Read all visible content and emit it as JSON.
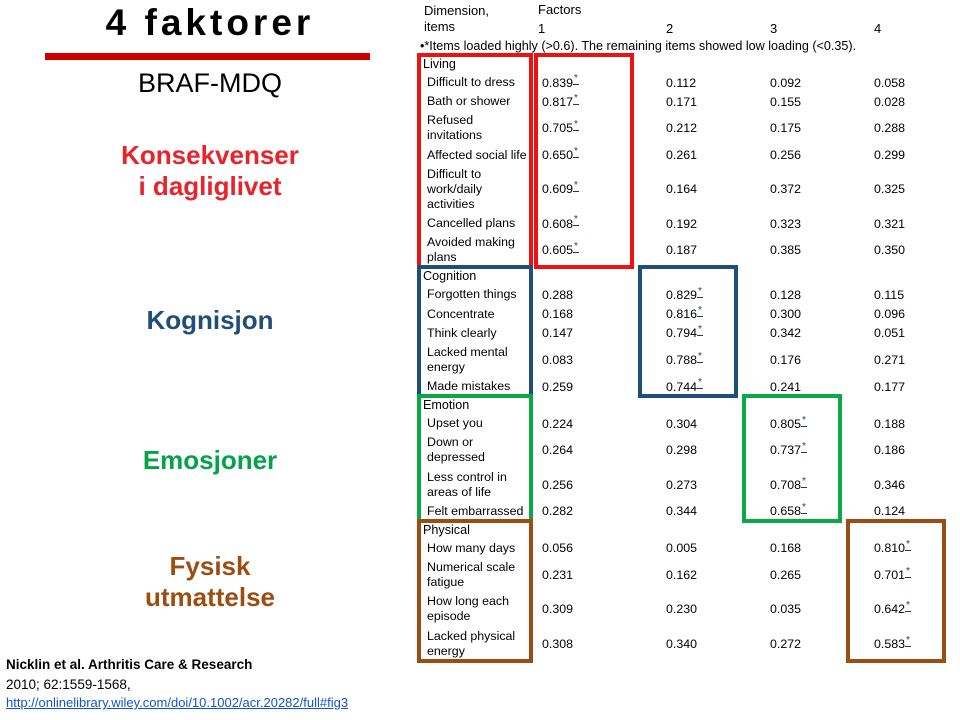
{
  "left": {
    "title": "4 faktorer",
    "subtitle": "BRAF-MDQ",
    "factor_labels": [
      {
        "text": "Konsekvenser\ni dagliglivet",
        "color": "#E8232A"
      },
      {
        "text": "Kognisjon",
        "color": "#1F4E79"
      },
      {
        "text": "Emosjoner",
        "color": "#06A24B"
      },
      {
        "text": "Fysisk\nutmattelse",
        "color": "#9C4D12"
      }
    ],
    "citation": {
      "line1": "Nicklin et al. Arthritis Care & Research",
      "line2": "2010; 62:1559-1568,",
      "link": "http://onlinelibrary.wiley.com/doi/10.1002/acr.20282/full#fig3"
    },
    "rule_color": "#CC0000"
  },
  "table": {
    "header": {
      "dimension_label": "Dimension,\nitems",
      "dimension_line1": "Dimension,",
      "dimension_line2": "items",
      "factors_label": "Factors",
      "factor_numbers": [
        "1",
        "2",
        "3",
        "4"
      ]
    },
    "note": "•*Items loaded highly (>0.6). The remaining items showed low loading (<0.35).",
    "sections": [
      {
        "name": "Living",
        "highlight_color": "#EE1111",
        "highlight_factor": 1,
        "rows": [
          {
            "item": "Difficult to dress",
            "values": [
              "0.839",
              "0.112",
              "0.092",
              "0.058"
            ],
            "starred": 1
          },
          {
            "item": "Bath or shower",
            "values": [
              "0.817",
              "0.171",
              "0.155",
              "0.028"
            ],
            "starred": 1
          },
          {
            "item": "Refused invitations",
            "values": [
              "0.705",
              "0.212",
              "0.175",
              "0.288"
            ],
            "starred": 1
          },
          {
            "item": "Affected social life",
            "values": [
              "0.650",
              "0.261",
              "0.256",
              "0.299"
            ],
            "starred": 1
          },
          {
            "item": "Difficult to work/daily activities",
            "values": [
              "0.609",
              "0.164",
              "0.372",
              "0.325"
            ],
            "starred": 1
          },
          {
            "item": "Cancelled plans",
            "values": [
              "0.608",
              "0.192",
              "0.323",
              "0.321"
            ],
            "starred": 1
          },
          {
            "item": "Avoided making plans",
            "values": [
              "0.605",
              "0.187",
              "0.385",
              "0.350"
            ],
            "starred": 1
          }
        ]
      },
      {
        "name": "Cognition",
        "highlight_color": "#1F4E79",
        "highlight_factor": 2,
        "rows": [
          {
            "item": "Forgotten things",
            "values": [
              "0.288",
              "0.829",
              "0.128",
              "0.115"
            ],
            "starred": 2
          },
          {
            "item": "Concentrate",
            "values": [
              "0.168",
              "0.816",
              "0.300",
              "0.096"
            ],
            "starred": 2
          },
          {
            "item": "Think clearly",
            "values": [
              "0.147",
              "0.794",
              "0.342",
              "0.051"
            ],
            "starred": 2
          },
          {
            "item": "Lacked mental energy",
            "values": [
              "0.083",
              "0.788",
              "0.176",
              "0.271"
            ],
            "starred": 2
          },
          {
            "item": "Made mistakes",
            "values": [
              "0.259",
              "0.744",
              "0.241",
              "0.177"
            ],
            "starred": 2
          }
        ]
      },
      {
        "name": "Emotion",
        "highlight_color": "#0BA84A",
        "highlight_factor": 3,
        "rows": [
          {
            "item": "Upset you",
            "values": [
              "0.224",
              "0.304",
              "0.805",
              "0.188"
            ],
            "starred": 3
          },
          {
            "item": "Down or depressed",
            "values": [
              "0.264",
              "0.298",
              "0.737",
              "0.186"
            ],
            "starred": 3
          },
          {
            "item": "Less control in areas of life",
            "values": [
              "0.256",
              "0.273",
              "0.708",
              "0.346"
            ],
            "starred": 3
          },
          {
            "item": "Felt embarrassed",
            "values": [
              "0.282",
              "0.344",
              "0.658",
              "0.124"
            ],
            "starred": 3
          }
        ]
      },
      {
        "name": "Physical",
        "highlight_color": "#9C4D12",
        "highlight_factor": 4,
        "rows": [
          {
            "item": "How many days",
            "values": [
              "0.056",
              "0.005",
              "0.168",
              "0.810"
            ],
            "starred": 4
          },
          {
            "item": "Numerical scale fatigue",
            "values": [
              "0.231",
              "0.162",
              "0.265",
              "0.701"
            ],
            "starred": 4
          },
          {
            "item": "How long each episode",
            "values": [
              "0.309",
              "0.230",
              "0.035",
              "0.642"
            ],
            "starred": 4
          },
          {
            "item": "Lacked physical energy",
            "values": [
              "0.308",
              "0.340",
              "0.272",
              "0.583"
            ],
            "starred": 4
          }
        ]
      }
    ]
  }
}
